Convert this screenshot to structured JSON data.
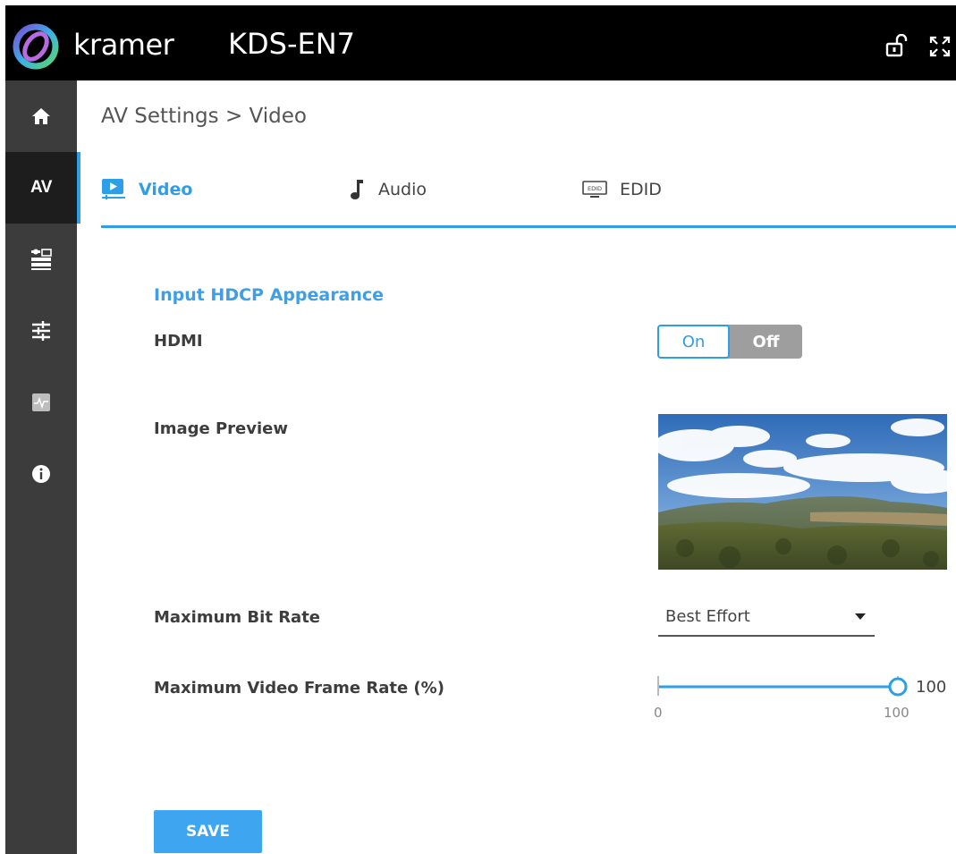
{
  "header": {
    "brand": "kramer",
    "device_name": "KDS-EN7",
    "icons": [
      "kramer-logo-icon",
      "lock-icon",
      "fullscreen-icon"
    ]
  },
  "sidebar": {
    "items": [
      {
        "icon": "home-icon"
      },
      {
        "label": "AV",
        "active": true
      },
      {
        "icon": "settings-panel-icon"
      },
      {
        "icon": "sliders-icon"
      },
      {
        "icon": "diagnostics-icon"
      },
      {
        "icon": "info-icon"
      }
    ]
  },
  "breadcrumb": "AV Settings > Video",
  "tabs": [
    {
      "label": "Video",
      "icon": "video-play-icon",
      "active": true
    },
    {
      "label": "Audio",
      "icon": "music-note-icon",
      "active": false
    },
    {
      "label": "EDID",
      "icon": "edid-icon",
      "active": false
    }
  ],
  "form": {
    "section_title": "Input HDCP Appearance",
    "hdmi_label": "HDMI",
    "toggle_on": "On",
    "toggle_off": "Off",
    "toggle_selected": "On",
    "image_preview_label": "Image Preview",
    "bit_rate_label": "Maximum Bit Rate",
    "bit_rate_value": "Best Effort",
    "frame_rate_label": "Maximum Video Frame Rate (%)",
    "frame_rate_value": "100",
    "frame_rate_min": "0",
    "frame_rate_max": "100",
    "save_label": "SAVE"
  },
  "colors": {
    "accent": "#2e9fe6",
    "topbar": "#000000",
    "sidebar": "#3c3c3c",
    "sidebar_active": "#1d1d1d"
  }
}
